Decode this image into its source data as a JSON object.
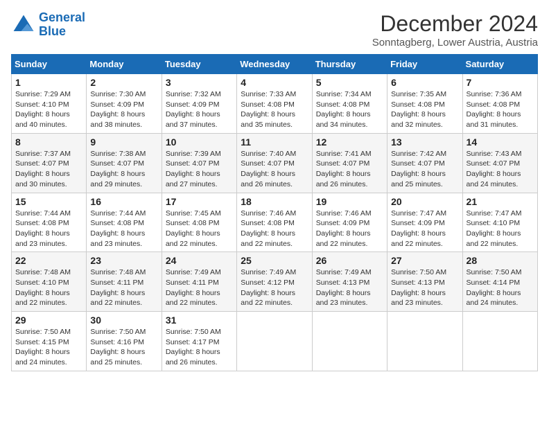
{
  "logo": {
    "line1": "General",
    "line2": "Blue"
  },
  "title": "December 2024",
  "subtitle": "Sonntagberg, Lower Austria, Austria",
  "days_of_week": [
    "Sunday",
    "Monday",
    "Tuesday",
    "Wednesday",
    "Thursday",
    "Friday",
    "Saturday"
  ],
  "weeks": [
    [
      {
        "day": "1",
        "sunrise": "7:29 AM",
        "sunset": "4:10 PM",
        "daylight": "8 hours and 40 minutes."
      },
      {
        "day": "2",
        "sunrise": "7:30 AM",
        "sunset": "4:09 PM",
        "daylight": "8 hours and 38 minutes."
      },
      {
        "day": "3",
        "sunrise": "7:32 AM",
        "sunset": "4:09 PM",
        "daylight": "8 hours and 37 minutes."
      },
      {
        "day": "4",
        "sunrise": "7:33 AM",
        "sunset": "4:08 PM",
        "daylight": "8 hours and 35 minutes."
      },
      {
        "day": "5",
        "sunrise": "7:34 AM",
        "sunset": "4:08 PM",
        "daylight": "8 hours and 34 minutes."
      },
      {
        "day": "6",
        "sunrise": "7:35 AM",
        "sunset": "4:08 PM",
        "daylight": "8 hours and 32 minutes."
      },
      {
        "day": "7",
        "sunrise": "7:36 AM",
        "sunset": "4:08 PM",
        "daylight": "8 hours and 31 minutes."
      }
    ],
    [
      {
        "day": "8",
        "sunrise": "7:37 AM",
        "sunset": "4:07 PM",
        "daylight": "8 hours and 30 minutes."
      },
      {
        "day": "9",
        "sunrise": "7:38 AM",
        "sunset": "4:07 PM",
        "daylight": "8 hours and 29 minutes."
      },
      {
        "day": "10",
        "sunrise": "7:39 AM",
        "sunset": "4:07 PM",
        "daylight": "8 hours and 27 minutes."
      },
      {
        "day": "11",
        "sunrise": "7:40 AM",
        "sunset": "4:07 PM",
        "daylight": "8 hours and 26 minutes."
      },
      {
        "day": "12",
        "sunrise": "7:41 AM",
        "sunset": "4:07 PM",
        "daylight": "8 hours and 26 minutes."
      },
      {
        "day": "13",
        "sunrise": "7:42 AM",
        "sunset": "4:07 PM",
        "daylight": "8 hours and 25 minutes."
      },
      {
        "day": "14",
        "sunrise": "7:43 AM",
        "sunset": "4:07 PM",
        "daylight": "8 hours and 24 minutes."
      }
    ],
    [
      {
        "day": "15",
        "sunrise": "7:44 AM",
        "sunset": "4:08 PM",
        "daylight": "8 hours and 23 minutes."
      },
      {
        "day": "16",
        "sunrise": "7:44 AM",
        "sunset": "4:08 PM",
        "daylight": "8 hours and 23 minutes."
      },
      {
        "day": "17",
        "sunrise": "7:45 AM",
        "sunset": "4:08 PM",
        "daylight": "8 hours and 22 minutes."
      },
      {
        "day": "18",
        "sunrise": "7:46 AM",
        "sunset": "4:08 PM",
        "daylight": "8 hours and 22 minutes."
      },
      {
        "day": "19",
        "sunrise": "7:46 AM",
        "sunset": "4:09 PM",
        "daylight": "8 hours and 22 minutes."
      },
      {
        "day": "20",
        "sunrise": "7:47 AM",
        "sunset": "4:09 PM",
        "daylight": "8 hours and 22 minutes."
      },
      {
        "day": "21",
        "sunrise": "7:47 AM",
        "sunset": "4:10 PM",
        "daylight": "8 hours and 22 minutes."
      }
    ],
    [
      {
        "day": "22",
        "sunrise": "7:48 AM",
        "sunset": "4:10 PM",
        "daylight": "8 hours and 22 minutes."
      },
      {
        "day": "23",
        "sunrise": "7:48 AM",
        "sunset": "4:11 PM",
        "daylight": "8 hours and 22 minutes."
      },
      {
        "day": "24",
        "sunrise": "7:49 AM",
        "sunset": "4:11 PM",
        "daylight": "8 hours and 22 minutes."
      },
      {
        "day": "25",
        "sunrise": "7:49 AM",
        "sunset": "4:12 PM",
        "daylight": "8 hours and 22 minutes."
      },
      {
        "day": "26",
        "sunrise": "7:49 AM",
        "sunset": "4:13 PM",
        "daylight": "8 hours and 23 minutes."
      },
      {
        "day": "27",
        "sunrise": "7:50 AM",
        "sunset": "4:13 PM",
        "daylight": "8 hours and 23 minutes."
      },
      {
        "day": "28",
        "sunrise": "7:50 AM",
        "sunset": "4:14 PM",
        "daylight": "8 hours and 24 minutes."
      }
    ],
    [
      {
        "day": "29",
        "sunrise": "7:50 AM",
        "sunset": "4:15 PM",
        "daylight": "8 hours and 24 minutes."
      },
      {
        "day": "30",
        "sunrise": "7:50 AM",
        "sunset": "4:16 PM",
        "daylight": "8 hours and 25 minutes."
      },
      {
        "day": "31",
        "sunrise": "7:50 AM",
        "sunset": "4:17 PM",
        "daylight": "8 hours and 26 minutes."
      },
      null,
      null,
      null,
      null
    ]
  ]
}
